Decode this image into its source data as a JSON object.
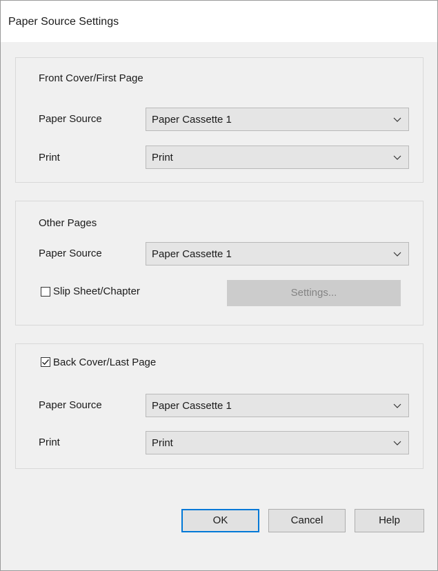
{
  "dialog": {
    "title": "Paper Source Settings"
  },
  "front": {
    "title": "Front Cover/First Page",
    "paper_source_label": "Paper Source",
    "paper_source_value": "Paper Cassette 1",
    "print_label": "Print",
    "print_value": "Print"
  },
  "other": {
    "title": "Other Pages",
    "paper_source_label": "Paper Source",
    "paper_source_value": "Paper Cassette 1",
    "slip_sheet_label": "Slip Sheet/Chapter",
    "slip_sheet_checked": false,
    "settings_button": "Settings..."
  },
  "back": {
    "checkbox_label": "Back Cover/Last Page",
    "checked": true,
    "paper_source_label": "Paper Source",
    "paper_source_value": "Paper Cassette 1",
    "print_label": "Print",
    "print_value": "Print"
  },
  "buttons": {
    "ok": "OK",
    "cancel": "Cancel",
    "help": "Help"
  },
  "icons": {
    "dropdown": "chevron-down-icon",
    "check": "checkmark-icon"
  },
  "colors": {
    "default_button_border": "#0078d7",
    "disabled_button_bg": "#cccccc"
  }
}
